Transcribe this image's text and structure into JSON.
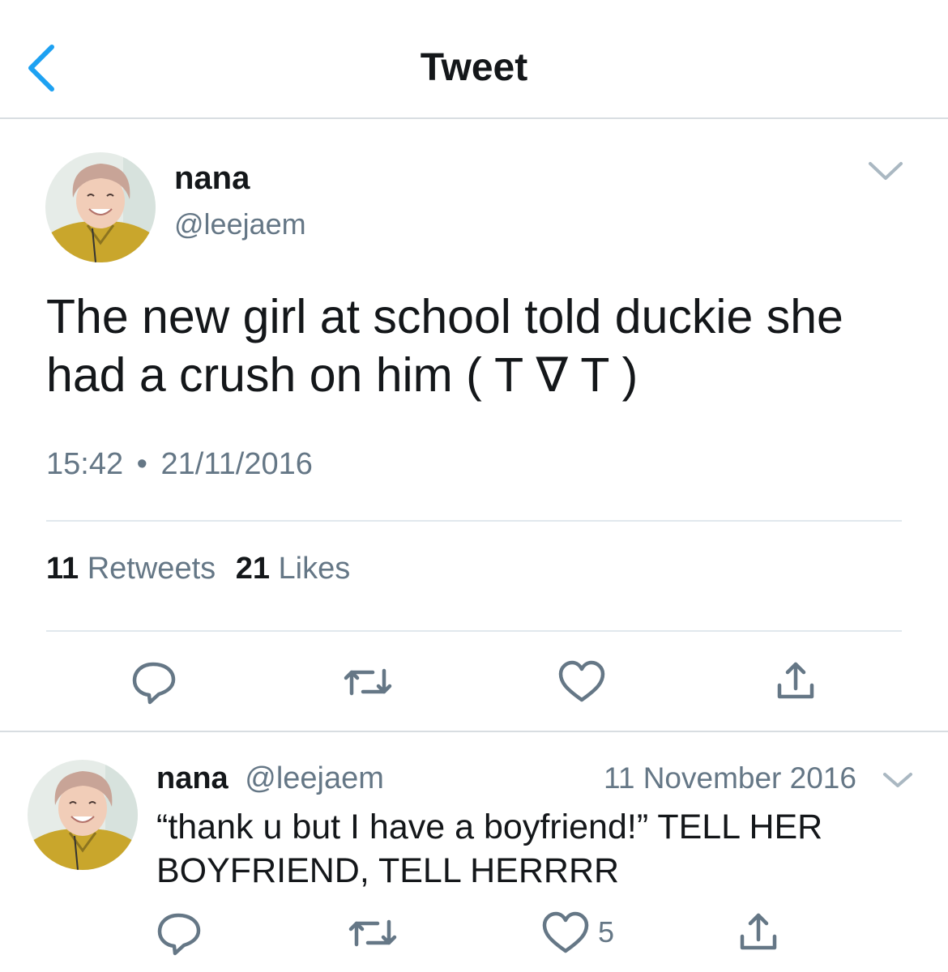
{
  "nav": {
    "title": "Tweet"
  },
  "tweet": {
    "name": "nana",
    "handle": "@leejaem",
    "text_line1": "The new girl at school told duckie she",
    "text_line2": "had a crush on him ( T ∇ T )",
    "time": "15:42",
    "separator": "•",
    "date": "21/11/2016",
    "retweets_count": "11",
    "retweets_label": "Retweets",
    "likes_count": "21",
    "likes_label": "Likes"
  },
  "reply": {
    "name": "nana",
    "handle": "@leejaem",
    "date": "11 November 2016",
    "text_line1": "“thank u but I have a boyfriend!” TELL HER",
    "text_line2": "BOYFRIEND, TELL HERRRR",
    "like_count": "5"
  },
  "icons": {
    "back": "chevron-left-icon",
    "caret": "chevron-down-icon",
    "reply": "reply-icon",
    "retweet": "retweet-icon",
    "like": "heart-icon",
    "share": "share-icon"
  },
  "colors": {
    "accent": "#1da1f2",
    "text": "#14171a",
    "secondary": "#657786",
    "divider": "#e1e8ed"
  }
}
